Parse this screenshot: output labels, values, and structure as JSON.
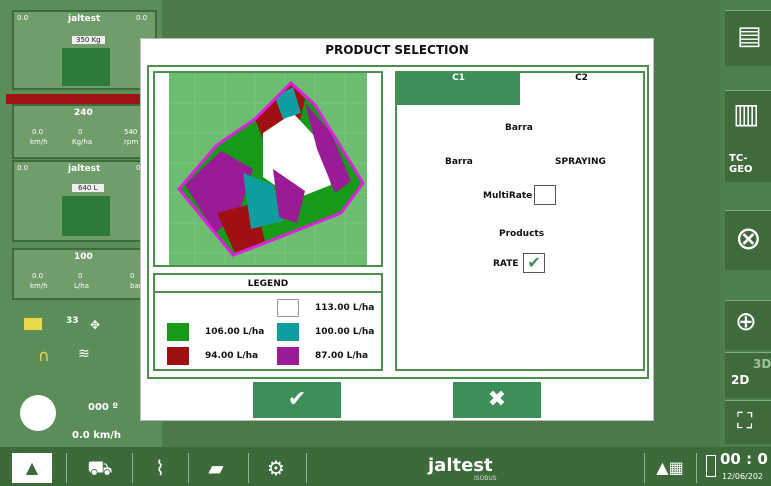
{
  "dialog": {
    "title": "PRODUCT SELECTION",
    "tabs": [
      "C1",
      "C2"
    ],
    "section_label": "Barra",
    "row_left": "Barra",
    "row_right": "SPRAYING",
    "multirate_label": "MultiRate",
    "products_label": "Products",
    "rate_label": "RATE",
    "legend": {
      "title": "LEGEND",
      "items": [
        {
          "value": "113.00 L/ha",
          "color": "#ffffff"
        },
        {
          "value": "106.00 L/ha",
          "color": "#169a18"
        },
        {
          "value": "100.00 L/ha",
          "color": "#0f9ea0"
        },
        {
          "value": "94.00 L/ha",
          "color": "#a01010"
        },
        {
          "value": "87.00 L/ha",
          "color": "#9a1a98"
        }
      ]
    },
    "confirm_icon": "check-icon",
    "cancel_icon": "close-icon"
  },
  "left_panel": {
    "brand": "jaltest",
    "tank_top": "350 Kg",
    "gauge1": {
      "value": "240",
      "speed": "0.0",
      "speed_unit": "km/h",
      "rate": "0",
      "rate_unit": "Kg/ha",
      "rpm": "540",
      "rpm_unit": "rpm"
    },
    "tank2": "640 L",
    "gauge2": {
      "value": "100",
      "speed": "0.0",
      "speed_unit": "km/h",
      "rate": "0",
      "rate_unit": "L/ha",
      "pressure": "0",
      "pressure_unit": "bar"
    },
    "satellites": "33",
    "heading": "000 º",
    "speed": "0.0 km/h",
    "corner_values": [
      "0.0",
      "0.0",
      "0.0",
      "0.0"
    ]
  },
  "right_panel": {
    "tc_geo": "TC-GEO",
    "mode2d": "2D",
    "mode3d": "3D"
  },
  "bottom": {
    "brand": "jaltest",
    "brand_sub": "ISOBUS",
    "time": "00 : 0",
    "date": "12/06/202"
  },
  "colors": {
    "accent": "#3d8f5a",
    "border": "#4f8f4d",
    "background": "#4a7a47"
  }
}
